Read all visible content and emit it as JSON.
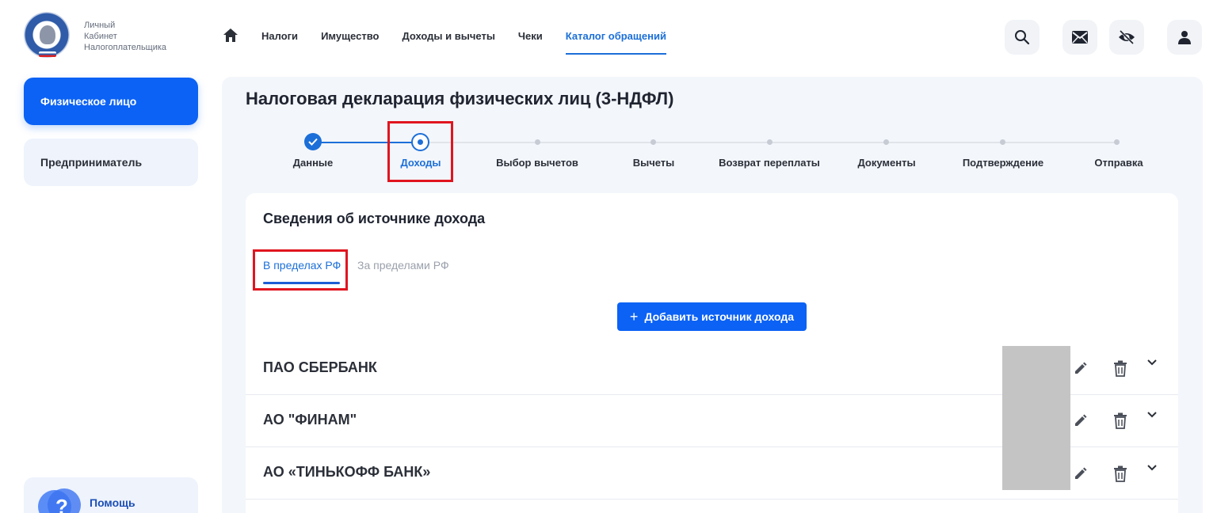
{
  "brand": {
    "line1": "Личный",
    "line2": "Кабинет",
    "line3": "Налогоплательщика"
  },
  "nav": {
    "items": [
      {
        "label": "Налоги"
      },
      {
        "label": "Имущество"
      },
      {
        "label": "Доходы и вычеты"
      },
      {
        "label": "Чеки"
      },
      {
        "label": "Каталог обращений"
      }
    ],
    "active_index": 4
  },
  "header_icons": [
    "search-icon",
    "mail-icon",
    "visibility-off-icon",
    "user-icon"
  ],
  "sidebar": {
    "individual": "Физическое лицо",
    "entrepreneur": "Предприниматель",
    "help": "Помощь"
  },
  "page": {
    "title": "Налоговая декларация физических лиц (3-НДФЛ)"
  },
  "stepper": {
    "steps": [
      {
        "label": "Данные",
        "status": "done"
      },
      {
        "label": "Доходы",
        "status": "current"
      },
      {
        "label": "Выбор вычетов",
        "status": "pending"
      },
      {
        "label": "Вычеты",
        "status": "pending"
      },
      {
        "label": "Возврат переплаты",
        "status": "pending"
      },
      {
        "label": "Документы",
        "status": "pending"
      },
      {
        "label": "Подтверждение",
        "status": "pending"
      },
      {
        "label": "Отправка",
        "status": "pending"
      }
    ]
  },
  "income": {
    "title": "Сведения об источнике дохода",
    "tabs": [
      {
        "label": "В пределах РФ",
        "active": true
      },
      {
        "label": "За пределами РФ",
        "active": false
      }
    ],
    "add_button": "Добавить источник дохода",
    "sources": [
      {
        "name": "ПАО СБЕРБАНК"
      },
      {
        "name": "АО \"ФИНАМ\""
      },
      {
        "name": "АО «ТИНЬКОФФ БАНК»"
      }
    ]
  },
  "colors": {
    "primary": "#0b62f5",
    "accent": "#1c6fd8",
    "highlight": "#e0151f"
  }
}
